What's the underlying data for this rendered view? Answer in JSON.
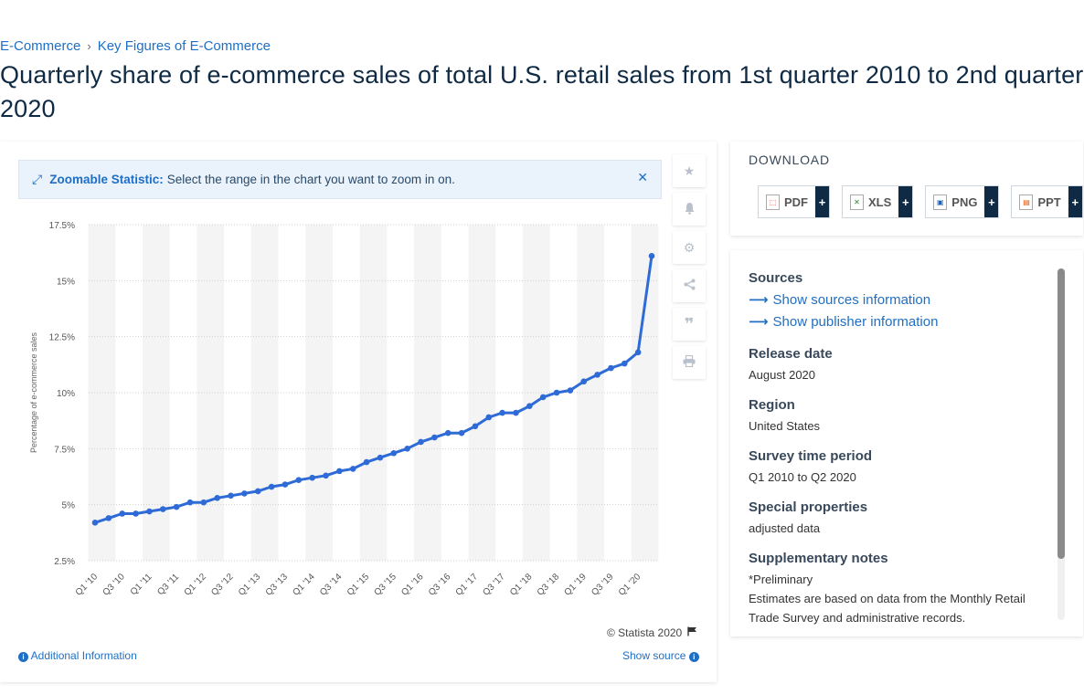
{
  "breadcrumb": {
    "item1": "E-Commerce",
    "separator": "›",
    "item2": "Key Figures of E-Commerce"
  },
  "title": "Quarterly share of e-commerce sales of total U.S. retail sales from 1st quarter 2010 to 2nd quarter 2020",
  "zoom": {
    "strong": "Zoomable Statistic:",
    "text": "Select the range in the chart you want to zoom in on.",
    "close": "✕"
  },
  "tools": [
    "star-icon",
    "bell-icon",
    "gear-icon",
    "share-icon",
    "quote-icon",
    "print-icon"
  ],
  "chart_data": {
    "type": "line",
    "title": "",
    "ylabel": "Percentage of e-commerce sales",
    "xlabel": "",
    "ylim": [
      2.5,
      17.5
    ],
    "yticks": [
      "2.5%",
      "5%",
      "7.5%",
      "10%",
      "12.5%",
      "15%",
      "17.5%"
    ],
    "ytick_values": [
      2.5,
      5,
      7.5,
      10,
      12.5,
      15,
      17.5
    ],
    "xtick_labels": [
      "Q1 '10",
      "Q3 '10",
      "Q1 '11",
      "Q3 '11",
      "Q1 '12",
      "Q3 '12",
      "Q1 '13",
      "Q3 '13",
      "Q1 '14",
      "Q3 '14",
      "Q1 '15",
      "Q3 '15",
      "Q1 '16",
      "Q3 '16",
      "Q1 '17",
      "Q3 '17",
      "Q1 '18",
      "Q3 '18",
      "Q1 '19",
      "Q3 '19",
      "Q1 '20"
    ],
    "color": "#2e6bd6",
    "grid": true,
    "values": [
      4.2,
      4.4,
      4.6,
      4.6,
      4.7,
      4.8,
      4.9,
      5.1,
      5.1,
      5.3,
      5.4,
      5.5,
      5.6,
      5.8,
      5.9,
      6.1,
      6.2,
      6.3,
      6.5,
      6.6,
      6.9,
      7.1,
      7.3,
      7.5,
      7.8,
      8.0,
      8.2,
      8.2,
      8.5,
      8.9,
      9.1,
      9.1,
      9.4,
      9.8,
      10.0,
      10.1,
      10.5,
      10.8,
      11.1,
      11.3,
      11.8,
      16.1
    ]
  },
  "copyright": "© Statista 2020",
  "additional_info": "Additional Information",
  "show_source": "Show source",
  "download": {
    "title": "DOWNLOAD",
    "buttons": [
      {
        "label": "PDF",
        "icon": "pdf-icon",
        "color": "#d32f2f"
      },
      {
        "label": "XLS",
        "icon": "xls-icon",
        "color": "#2e7d32"
      },
      {
        "label": "PNG",
        "icon": "png-icon",
        "color": "#1565c0"
      },
      {
        "label": "PPT",
        "icon": "ppt-icon",
        "color": "#e65100"
      }
    ],
    "plus": "+"
  },
  "info": {
    "sources_head": "Sources",
    "show_sources": "Show sources information",
    "show_publisher": "Show publisher information",
    "release_head": "Release date",
    "release_val": "August 2020",
    "region_head": "Region",
    "region_val": "United States",
    "survey_head": "Survey time period",
    "survey_val": "Q1 2010 to Q2 2020",
    "special_head": "Special properties",
    "special_val": "adjusted data",
    "supp_head": "Supplementary notes",
    "supp_val1": "*Preliminary",
    "supp_val2": "Estimates are based on data from the Monthly Retail Trade Survey and administrative records."
  }
}
